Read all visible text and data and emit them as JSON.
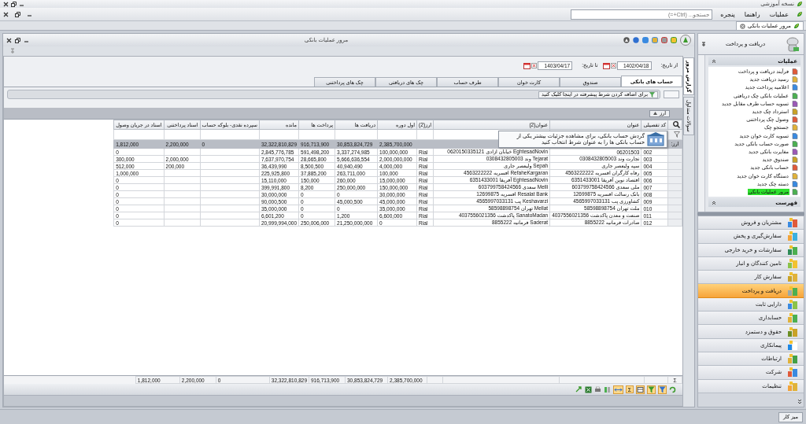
{
  "app": {
    "title": "نسخه آموزشی"
  },
  "menu": [
    {
      "label": "عملیات"
    },
    {
      "label": "راهنما"
    },
    {
      "label": "پنجره"
    }
  ],
  "search": {
    "placeholder": "جستجو... (Ctrl+=)"
  },
  "doc_tabs": [
    {
      "label": "مرور عملیات بانکی",
      "selected": true
    }
  ],
  "window": {
    "title": "مرور عملیات بانکی"
  },
  "side_tabs": [
    {
      "label": "گزارش مرور",
      "selected": true
    },
    {
      "label": "سوالات متداول",
      "selected": false
    }
  ],
  "filters": [
    {
      "label": "از تاریخ:",
      "value": "1402/04/18"
    },
    {
      "label": "تا تاریخ:",
      "value": "1403/04/17"
    }
  ],
  "tabs": [
    {
      "label": "حساب های بانکی",
      "selected": true
    },
    {
      "label": "صندوق",
      "selected": false
    },
    {
      "label": "کارت خوان",
      "selected": false
    },
    {
      "label": "طرف حساب",
      "selected": false
    },
    {
      "label": "چک های دریافتی",
      "selected": false
    },
    {
      "label": "چک های پرداختنی",
      "selected": false
    }
  ],
  "filter_hint": "برای اضافه کردن شرط پیشرفته در اینجا کلیک کنید",
  "group_by": {
    "label": "ارز"
  },
  "table": {
    "columns": [
      "کد تفصیلی",
      "عنوان",
      "عنوان(2)",
      "ارز(2)",
      "اول دوره",
      "دریافت ها",
      "پرداخت ها",
      "مانده",
      "سپرده نقدی- بلوکه حساب",
      "اسناد پرداختنی",
      "اسناد در جریان وصول"
    ],
    "group_row": {
      "label": "ارز:",
      "cells": [
        null,
        null,
        null,
        null,
        "2,385,700,000",
        "30,853,824,729",
        "916,713,900",
        "32,322,810,829",
        "0",
        "2,200,000",
        "1,812,000"
      ]
    },
    "rows": [
      {
        "cells": [
          "002",
          "06201503",
          "EghtesadNovin خیابان ازادی 0620150335121",
          "Rial",
          "100,000,000",
          "3,337,274,985",
          "591,498,200",
          "2,845,776,785",
          null,
          null,
          "0"
        ]
      },
      {
        "cells": [
          "003",
          "تجارت وند 0308432805003",
          "Tejarat وند 0308432805003",
          "Rial",
          "2,000,000,000",
          "5,666,636,554",
          "28,665,800",
          "7,637,970,754",
          null,
          "2,000,000",
          "300,000"
        ]
      },
      {
        "cells": [
          "004",
          "سپه ولیعصر جاری",
          "Sepah ولیعصر جاری",
          "Rial",
          "4,000,000",
          "40,940,490",
          "8,500,500",
          "36,439,990",
          null,
          "200,000",
          "512,000"
        ]
      },
      {
        "cells": [
          "005",
          "رفاه کارگران افسریه 4563222222",
          "RefaheKargaran افسریه 4563222222",
          "Rial",
          "100,000",
          "263,711,000",
          "37,885,200",
          "225,925,800",
          null,
          null,
          "1,000,000"
        ]
      },
      {
        "cells": [
          "006",
          "اقتصاد نوین آفریقا 6351433001",
          "EghtesadNovin آفریقا 6351433001",
          "Rial",
          "15,000,000",
          "260,000",
          "150,000",
          "15,110,000",
          null,
          null,
          "0"
        ]
      },
      {
        "cells": [
          "007",
          "ملی سعدی 603799758424566",
          "Melli سعدی 603799758424566",
          "Rial",
          "150,000,000",
          "250,000,000",
          "8,200",
          "399,991,800",
          null,
          null,
          "0"
        ]
      },
      {
        "cells": [
          "008",
          "بانک رسالت افسریه 12699875",
          "Resalat Bank افسریه 12699875",
          "Rial",
          "30,000,000",
          "0",
          "0",
          "30,000,000",
          null,
          null,
          "0"
        ]
      },
      {
        "cells": [
          "009",
          "کشاورزی پب 4565997033131",
          "Keshavarzi پب 4565997033131",
          "Rial",
          "45,000,000",
          "45,000,500",
          "0",
          "90,000,500",
          null,
          null,
          "0"
        ]
      },
      {
        "cells": [
          "010",
          "ملت تهران 58598898754",
          "Mellat تهران 58598898754",
          "Rial",
          "35,000,000",
          "0",
          "0",
          "35,000,000",
          null,
          null,
          "0"
        ]
      },
      {
        "cells": [
          "011",
          "صنعت و معدن پاکدشت 4037556021356",
          "SanatoMadan پاکدشت 4037556021356",
          "Rial",
          "6,600,000",
          "1,200",
          "0",
          "6,601,200",
          null,
          null,
          "0"
        ]
      },
      {
        "cells": [
          "012",
          "صادرات فرمانیه 8855222",
          "Saderat فرمانیه 8855222",
          "Rial",
          "0",
          "21,250,000,000",
          "250,006,000",
          "20,999,994,000",
          null,
          null,
          "0"
        ]
      }
    ],
    "footer": {
      "label": "Σ",
      "cells": [
        null,
        null,
        null,
        null,
        "2,385,700,000",
        "30,853,824,729",
        "916,713,900",
        "32,322,810,829",
        "0",
        "2,200,000",
        "1,812,000"
      ]
    }
  },
  "tooltip": {
    "text": "گردش حساب بانکی، برای مشاهده جزئیات بیشتر یکی از حساب بانکی ها را به عنوان شرط انتخاب کنید"
  },
  "grid_toolbar": {
    "sum": "Σ"
  },
  "sidebar": {
    "header": "دریافت و پرداخت",
    "sections": [
      {
        "title": "عملیات",
        "items": [
          {
            "label": "فرآیند دریافت و پرداخت",
            "selected": false
          },
          {
            "label": "رسید دریافت جدید",
            "selected": false
          },
          {
            "label": "اعلامیه پرداخت جدید",
            "selected": false
          },
          {
            "label": "عملیات بانکی چک دریافتی",
            "selected": false
          },
          {
            "label": "تسویه حساب طرف مقابل جدید",
            "selected": false
          },
          {
            "label": "استرداد چک جدید",
            "selected": false
          },
          {
            "label": "وصول چک پرداختنی",
            "selected": false
          },
          {
            "label": "جستجو چک",
            "selected": false
          },
          {
            "label": "تسویه کارت خوان جدید",
            "selected": false
          },
          {
            "label": "صورت حساب بانکی جدید",
            "selected": false
          },
          {
            "label": "مغایرت بانکی جدید",
            "selected": false
          },
          {
            "label": "صندوق جدید",
            "selected": false
          },
          {
            "label": "حساب بانکی جدید",
            "selected": false
          },
          {
            "label": "دستگاه کارت خوان جدید",
            "selected": false
          },
          {
            "label": "دسته چک جدید",
            "selected": false
          },
          {
            "label": "مرور عملیات بانکی",
            "selected": true
          }
        ]
      },
      {
        "title": "فهرست"
      }
    ],
    "modules": [
      {
        "label": "مشتریان و فروش",
        "selected": false
      },
      {
        "label": "سفارش‌گیری و پخش",
        "selected": false
      },
      {
        "label": "سفارشات و خرید خارجی",
        "selected": false
      },
      {
        "label": "تامین کنندگان و انبار",
        "selected": false
      },
      {
        "label": "سفارش کار",
        "selected": false
      },
      {
        "label": "دریافت و پرداخت",
        "selected": true
      },
      {
        "label": "دارایی ثابت",
        "selected": false
      },
      {
        "label": "حسابداری",
        "selected": false
      },
      {
        "label": "حقوق و دستمزد",
        "selected": false
      },
      {
        "label": "پیمانکاری",
        "selected": false
      },
      {
        "label": "ارتباطات",
        "selected": false
      },
      {
        "label": "شرکت",
        "selected": false
      },
      {
        "label": "تنظیمات",
        "selected": false
      }
    ]
  },
  "taskbar": [
    {
      "label": "میز کار"
    }
  ]
}
